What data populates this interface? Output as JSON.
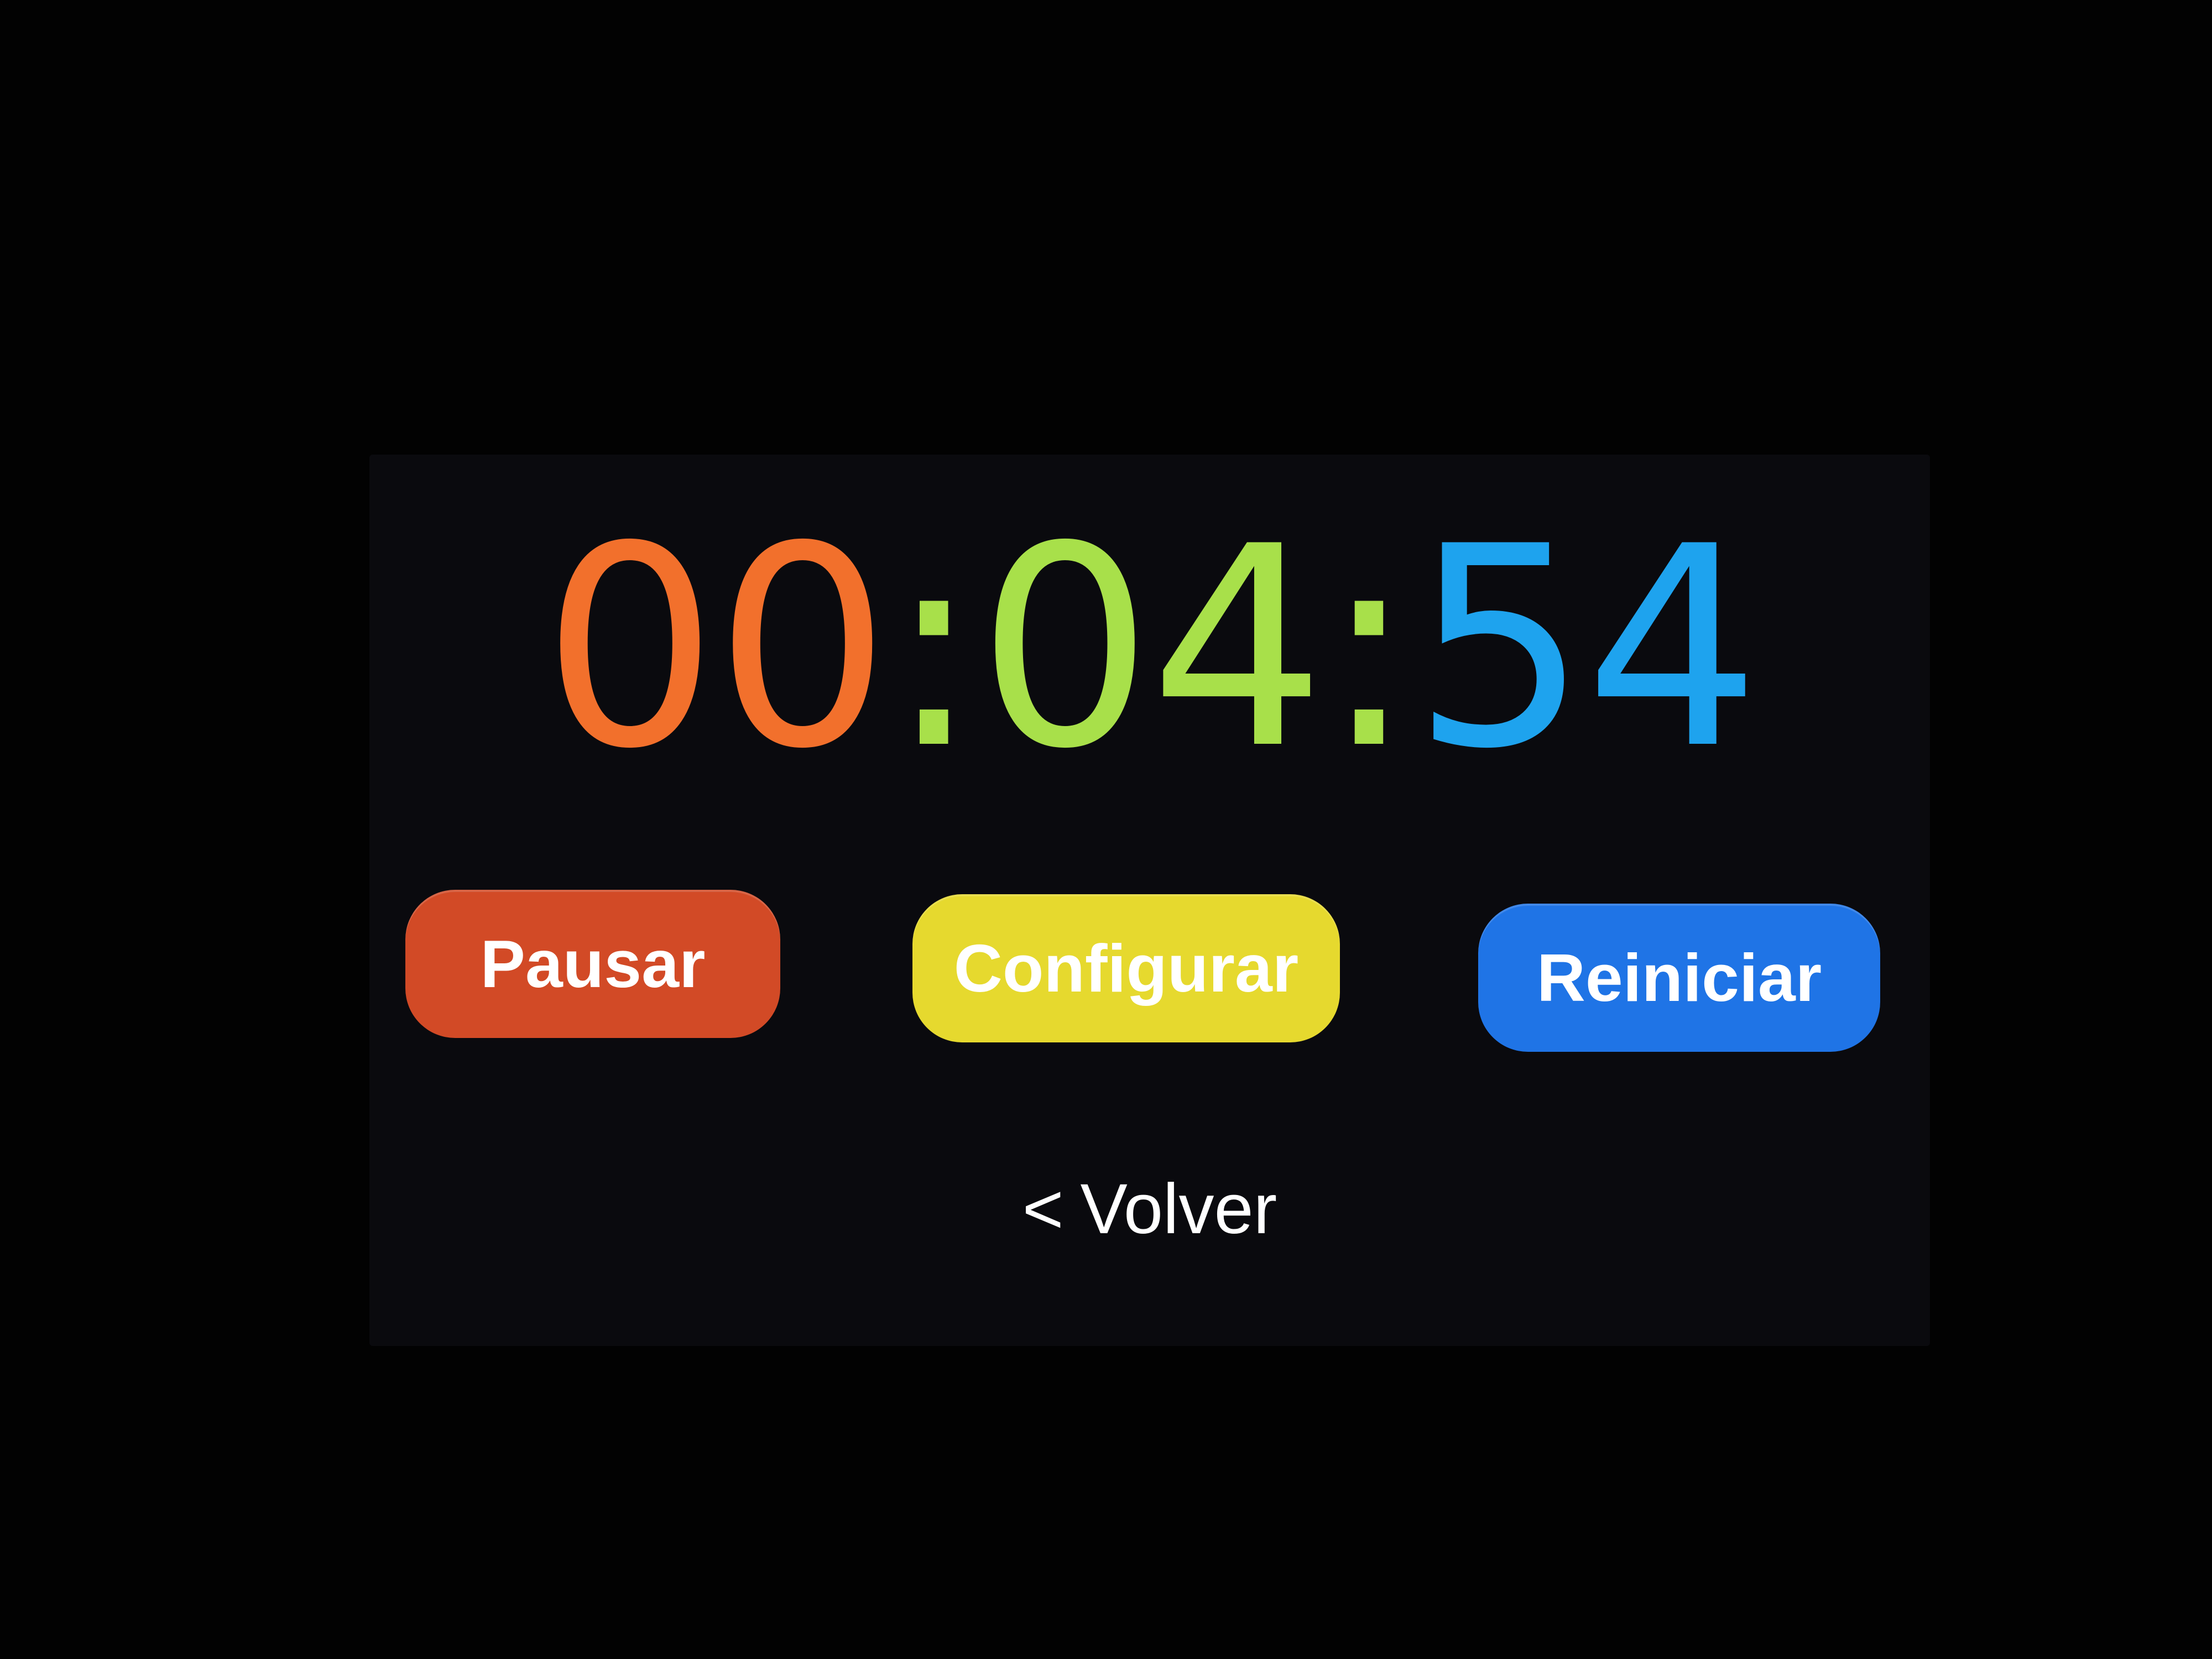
{
  "timer": {
    "hours": "00",
    "minutes": "04",
    "seconds": "54",
    "separator": ":"
  },
  "buttons": {
    "pause_label": "Pausar",
    "configure_label": "Configurar",
    "reset_label": "Reiniciar"
  },
  "navigation": {
    "back_chevron": "<",
    "back_label": "Volver"
  },
  "colors": {
    "hours": "#f2702c",
    "minutes": "#a8e04a",
    "seconds": "#1ea3ee",
    "pause_button": "#d24a26",
    "configure_button": "#e6d92e",
    "reset_button": "#1f74e6",
    "screen_background": "#0a0a0e"
  },
  "icons": {
    "back": "chevron-left-icon"
  }
}
